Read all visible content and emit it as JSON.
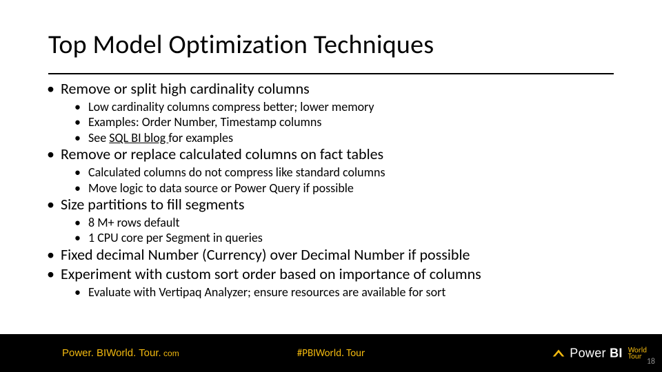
{
  "title": "Top Model Optimization Techniques",
  "bullets": {
    "b1_1": "Remove or split high cardinality columns",
    "b1_1_s1": "Low cardinality columns compress better; lower memory",
    "b1_1_s2": "Examples: Order Number, Timestamp columns",
    "b1_1_s3_pre": "See ",
    "b1_1_s3_link": "SQL BI blog ",
    "b1_1_s3_post": "for examples",
    "b1_2": "Remove or replace calculated columns on fact tables",
    "b1_2_s1": "Calculated columns do not compress like standard columns",
    "b1_2_s2": "Move logic to data source or Power Query if possible",
    "b1_3": "Size partitions to fill segments",
    "b1_3_s1": "8 M+ rows default",
    "b1_3_s2": "1 CPU core per Segment in queries",
    "b1_4": "Fixed decimal Number (Currency) over Decimal Number if possible",
    "b1_5": "Experiment with custom sort order based on importance of columns",
    "b1_5_s1": "Evaluate with Vertipaq Analyzer; ensure resources are available for sort"
  },
  "footer": {
    "left_main": "Power. BIWorld. Tour.",
    "left_suffix": " com",
    "center": "#PBIWorld. Tour",
    "brand_pre": "Power ",
    "brand_bold": "BI",
    "brand_wt1": "World",
    "brand_wt2": "Tour",
    "page": "18"
  }
}
